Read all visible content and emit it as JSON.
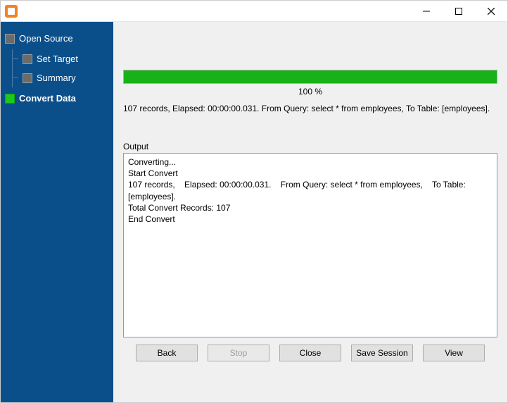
{
  "window": {
    "title": ""
  },
  "sidebar": {
    "root": {
      "label": "Open Source"
    },
    "children": [
      {
        "label": "Set Target"
      },
      {
        "label": "Summary"
      }
    ],
    "active": {
      "label": "Convert Data"
    }
  },
  "progress": {
    "percent_text": "100 %",
    "percent_value": 100
  },
  "status_line": "107 records,    Elapsed: 00:00:00.031.    From Query: select * from employees,    To Table: [employees].",
  "output": {
    "label": "Output",
    "text": "Converting...\nStart Convert\n107 records,    Elapsed: 00:00:00.031.    From Query: select * from employees,    To Table: [employees].\nTotal Convert Records: 107\nEnd Convert\n"
  },
  "buttons": {
    "back": "Back",
    "stop": "Stop",
    "close": "Close",
    "save_session": "Save Session",
    "view": "View"
  },
  "colors": {
    "sidebar_bg": "#0b4f8a",
    "progress_fill": "#18b218",
    "app_icon": "#f58220"
  }
}
